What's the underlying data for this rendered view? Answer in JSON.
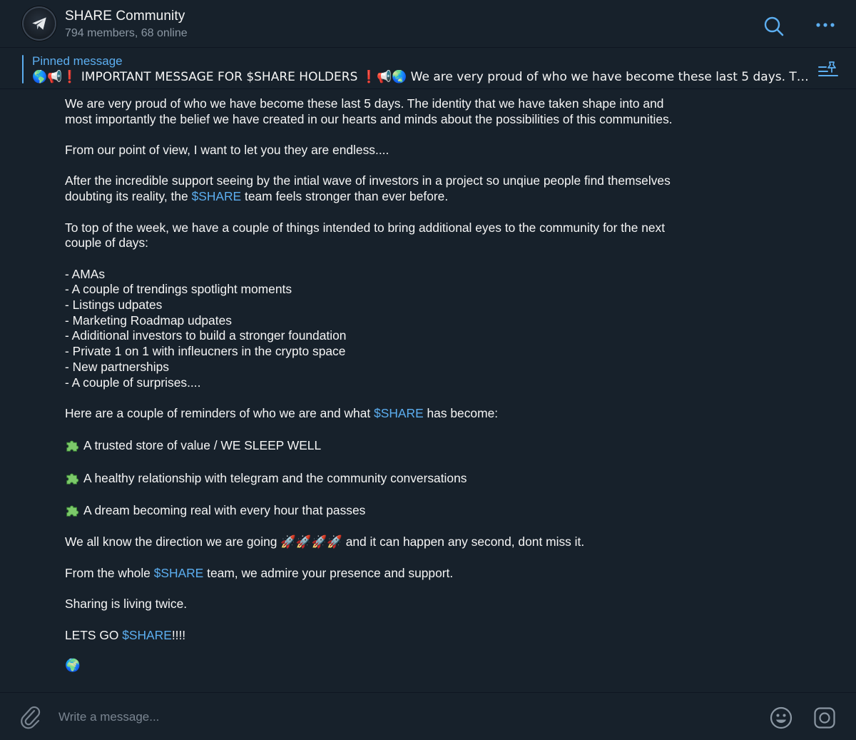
{
  "header": {
    "title": "SHARE Community",
    "subtitle": "794 members, 68 online"
  },
  "pinned": {
    "label": "Pinned message",
    "text": "🌎📢❗ IMPORTANT MESSAGE FOR $SHARE HOLDERS ❗📢🌏  We are very proud of who we have become these last 5 days. The identity that we have taken shape into"
  },
  "message": {
    "p1": "We are very proud of who we have become these last 5 days. The identity that we have taken shape into and most importantly the belief we have created in our hearts and minds about the possibilities of this communities.",
    "p2": "From our point of view, I want to let you they are endless....",
    "p3_a": "After the incredible support seeing by the intial wave of investors in a project so unqiue people find themselves doubting its reality, the ",
    "p3_link": "$SHARE",
    "p3_b": " team feels stronger than ever before.",
    "p4": "To top of the week, we have a couple of things intended to bring additional eyes to the community for the next couple of days:",
    "list": [
      "- AMAs",
      "- A couple of trendings spotlight moments",
      "- Listings udpates",
      "- Marketing Roadmap udpates",
      "- Adiditional investors to build a stronger foundation",
      "- Private 1 on 1 with infleucners in the crypto space",
      "- New partnerships",
      "- A couple of surprises...."
    ],
    "p5_a": "Here are a couple of reminders of who we are and what ",
    "p5_link": "$SHARE",
    "p5_b": " has become:",
    "bullets": [
      "A trusted store of value / WE SLEEP WELL",
      "A healthy relationship with telegram and the community conversations",
      "A dream becoming real with every hour that passes"
    ],
    "p6_a": "We all know the direction we are going ",
    "p6_emoji": "🚀🚀🚀🚀",
    "p6_b": " and it can happen any second, dont miss it.",
    "p7_a": "From the whole ",
    "p7_link": "$SHARE",
    "p7_b": " team, we admire your presence and support.",
    "p8": "Sharing is living twice.",
    "p9_a": "LETS GO ",
    "p9_link": "$SHARE",
    "p9_b": "!!!!",
    "p10": "🌍"
  },
  "composer": {
    "placeholder": "Write a message..."
  },
  "icons": {
    "avatar": "telegram-plane-icon",
    "search": "search-icon",
    "more": "more-dots-icon",
    "pin": "pinned-list-icon",
    "bullet": "puzzle-piece-icon",
    "attach": "paperclip-icon",
    "emoji": "emoji-smile-icon",
    "camera": "instagram-camera-icon"
  },
  "colors": {
    "background": "#17212b",
    "accent": "#5caef0",
    "text": "#f5f5f5",
    "muted": "#8b97a3"
  }
}
